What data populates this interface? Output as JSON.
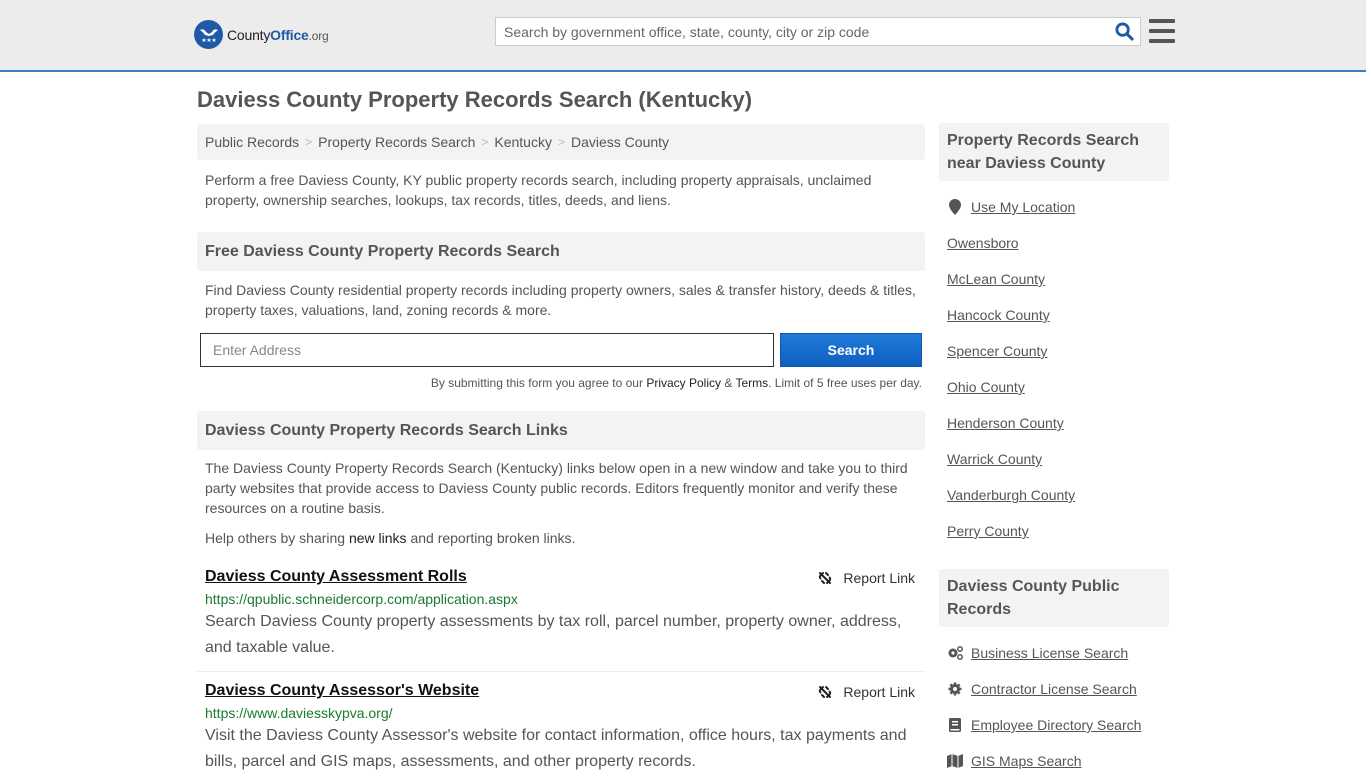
{
  "header": {
    "logo": {
      "county": "County",
      "office": "Office",
      "org": ".org"
    },
    "search_placeholder": "Search by government office, state, county, city or zip code",
    "search_icon": "search-icon",
    "menu_icon": "hamburger-menu-icon"
  },
  "page_title": "Daviess County Property Records Search (Kentucky)",
  "breadcrumb": [
    {
      "label": "Public Records"
    },
    {
      "label": "Property Records Search"
    },
    {
      "label": "Kentucky"
    },
    {
      "label": "Daviess County"
    }
  ],
  "intro": "Perform a free Daviess County, KY public property records search, including property appraisals, unclaimed property, ownership searches, lookups, tax records, titles, deeds, and liens.",
  "free_search": {
    "heading": "Free Daviess County Property Records Search",
    "description": "Find Daviess County residential property records including property owners, sales & transfer history, deeds & titles, property taxes, valuations, land, zoning records & more.",
    "address_placeholder": "Enter Address",
    "search_label": "Search",
    "disclaimer_prefix": "By submitting this form you agree to our ",
    "privacy_label": "Privacy Policy",
    "amp": " & ",
    "terms_label": "Terms",
    "disclaimer_suffix": ". Limit of 5 free uses per day."
  },
  "links_section": {
    "heading": "Daviess County Property Records Search Links",
    "description": "The Daviess County Property Records Search (Kentucky) links below open in a new window and take you to third party websites that provide access to Daviess County public records. Editors frequently monitor and verify these resources on a routine basis.",
    "help_prefix": "Help others by sharing ",
    "help_link": "new links",
    "help_suffix": " and reporting broken links.",
    "report_label": "Report Link",
    "items": [
      {
        "title": "Daviess County Assessment Rolls",
        "url": "https://qpublic.schneidercorp.com/application.aspx",
        "description": "Search Daviess County property assessments by tax roll, parcel number, property owner, address, and taxable value."
      },
      {
        "title": "Daviess County Assessor's Website",
        "url": "https://www.daviesskypva.org/",
        "description": "Visit the Daviess County Assessor's website for contact information, office hours, tax payments and bills, parcel and GIS maps, assessments, and other property records."
      }
    ]
  },
  "sidebar": {
    "nearby": {
      "heading": "Property Records Search near Daviess County",
      "use_location": "Use My Location",
      "items": [
        "Owensboro",
        "McLean County",
        "Hancock County",
        "Spencer County",
        "Ohio County",
        "Henderson County",
        "Warrick County",
        "Vanderburgh County",
        "Perry County"
      ]
    },
    "public_records": {
      "heading": "Daviess County Public Records",
      "items": [
        {
          "label": "Business License Search",
          "icon": "gears-icon"
        },
        {
          "label": "Contractor License Search",
          "icon": "gear-icon"
        },
        {
          "label": "Employee Directory Search",
          "icon": "book-icon"
        },
        {
          "label": "GIS Maps Search",
          "icon": "map-icon"
        }
      ]
    }
  },
  "colors": {
    "accent": "#3a7fc1",
    "brand": "#1f5aa6",
    "button": "#1469cc",
    "url": "#1a7a2e"
  }
}
